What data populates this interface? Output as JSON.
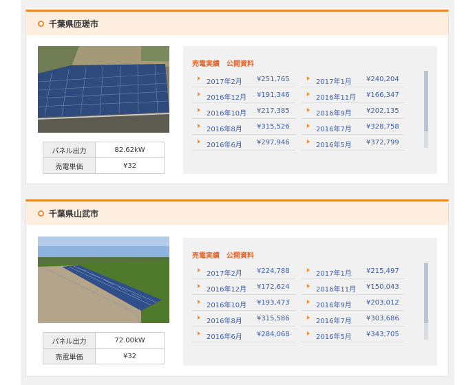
{
  "sites": [
    {
      "title": "千葉県匝瑳市",
      "spec": {
        "panel_label": "パネル出力",
        "panel_value": "82.62kW",
        "price_label": "売電単価",
        "price_value": "¥32"
      },
      "results_title": "売電実績　公開資料",
      "entries": [
        {
          "month": "2017年2月",
          "amount": "¥251,765"
        },
        {
          "month": "2017年1月",
          "amount": "¥240,204"
        },
        {
          "month": "2016年12月",
          "amount": "¥191,346"
        },
        {
          "month": "2016年11月",
          "amount": "¥166,347"
        },
        {
          "month": "2016年10月",
          "amount": "¥217,385"
        },
        {
          "month": "2016年9月",
          "amount": "¥202,135"
        },
        {
          "month": "2016年8月",
          "amount": "¥315,526"
        },
        {
          "month": "2016年7月",
          "amount": "¥328,758"
        },
        {
          "month": "2016年6月",
          "amount": "¥297,946"
        },
        {
          "month": "2016年5月",
          "amount": "¥372,799"
        }
      ]
    },
    {
      "title": "千葉県山武市",
      "spec": {
        "panel_label": "パネル出力",
        "panel_value": "72.00kW",
        "price_label": "売電単価",
        "price_value": "¥32"
      },
      "results_title": "売電実績　公開資料",
      "entries": [
        {
          "month": "2017年2月",
          "amount": "¥224,788"
        },
        {
          "month": "2017年1月",
          "amount": "¥215,497"
        },
        {
          "month": "2016年12月",
          "amount": "¥172,624"
        },
        {
          "month": "2016年11月",
          "amount": "¥150,043"
        },
        {
          "month": "2016年10月",
          "amount": "¥193,473"
        },
        {
          "month": "2016年9月",
          "amount": "¥203,012"
        },
        {
          "month": "2016年8月",
          "amount": "¥315,586"
        },
        {
          "month": "2016年7月",
          "amount": "¥303,686"
        },
        {
          "month": "2016年6月",
          "amount": "¥284,068"
        },
        {
          "month": "2016年5月",
          "amount": "¥343,705"
        }
      ]
    }
  ],
  "colors": {
    "accent": "#ef8a2b",
    "header_bg": "#fdeee0",
    "link": "#3d5d9f",
    "results_title": "#e0662a"
  }
}
